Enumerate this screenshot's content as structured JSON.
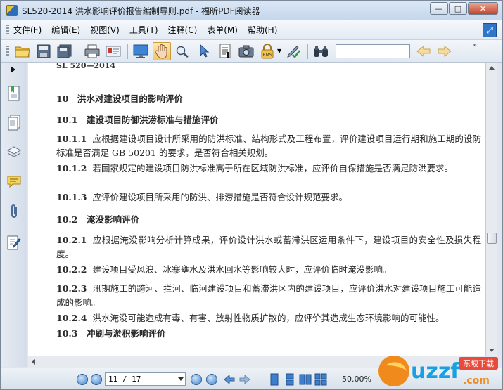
{
  "window": {
    "title": "SL520-2014 洪水影响评价报告编制导则.pdf - 福昕PDF阅读器",
    "min_symbol": "—",
    "max_symbol": "□",
    "close_symbol": "✕"
  },
  "menu": {
    "items": [
      "文件(F)",
      "编辑(E)",
      "视图(V)",
      "工具(T)",
      "注释(C)",
      "表单(M)",
      "帮助(H)"
    ],
    "expand_symbol": "⤢"
  },
  "toolbar": {
    "search_value": "",
    "more_symbol": "»"
  },
  "document": {
    "header": "SL 520—2014",
    "blocks": [
      {
        "type": "h",
        "text": "10　洪水对建设项目的影响评价"
      },
      {
        "type": "h",
        "text": "10.1　建设项目防御洪涝标准与措施评价"
      },
      {
        "type": "p",
        "num": "10.1.1",
        "text": "应根据建设项目设计所采用的防洪标准、结构形式及工程布置，评价建设项目运行期和施工期的设防标准是否满足 GB 50201 的要求，是否符合相关规划。"
      },
      {
        "type": "p",
        "num": "10.1.2",
        "text": "若国家规定的建设项目防洪标准高于所在区域防洪标准，应评价自保措施是否满足防洪要求。"
      },
      {
        "type": "p",
        "num": "10.1.3",
        "text": "应评价建设项目所采用的防洪、排涝措施是否符合设计规范要求。"
      },
      {
        "type": "h",
        "text": "10.2　淹没影响评价"
      },
      {
        "type": "p",
        "num": "10.2.1",
        "text": "应根据淹没影响分析计算成果，评价设计洪水或蓄滞洪区运用条件下，建设项目的安全性及损失程度。"
      },
      {
        "type": "p",
        "num": "10.2.2",
        "text": "建设项目受风浪、冰寨壅水及洪水回水等影响较大时，应评价临时淹没影响。"
      },
      {
        "type": "p",
        "num": "10.2.3",
        "text": "汛期施工的跨河、拦河、临河建设项目和蓄滞洪区内的建设项目，应评价洪水对建设项目施工可能造成的影响。"
      },
      {
        "type": "p",
        "num": "10.2.4",
        "text": "洪水淹没可能造成有毒、有害、放射性物质扩散的，应评价其造成生态环境影响的可能性。"
      },
      {
        "type": "h",
        "text": "10.3　冲刷与淤积影响评价"
      }
    ]
  },
  "status": {
    "page_display": "11 / 17",
    "zoom": "50.00%"
  },
  "watermark": {
    "text": "uzzf",
    "subtext": "东坡下载",
    "domain": ".com"
  },
  "colors": {
    "accent": "#2f76c8",
    "title_bar": "#c4d6ec",
    "close_button": "#c5452a"
  }
}
